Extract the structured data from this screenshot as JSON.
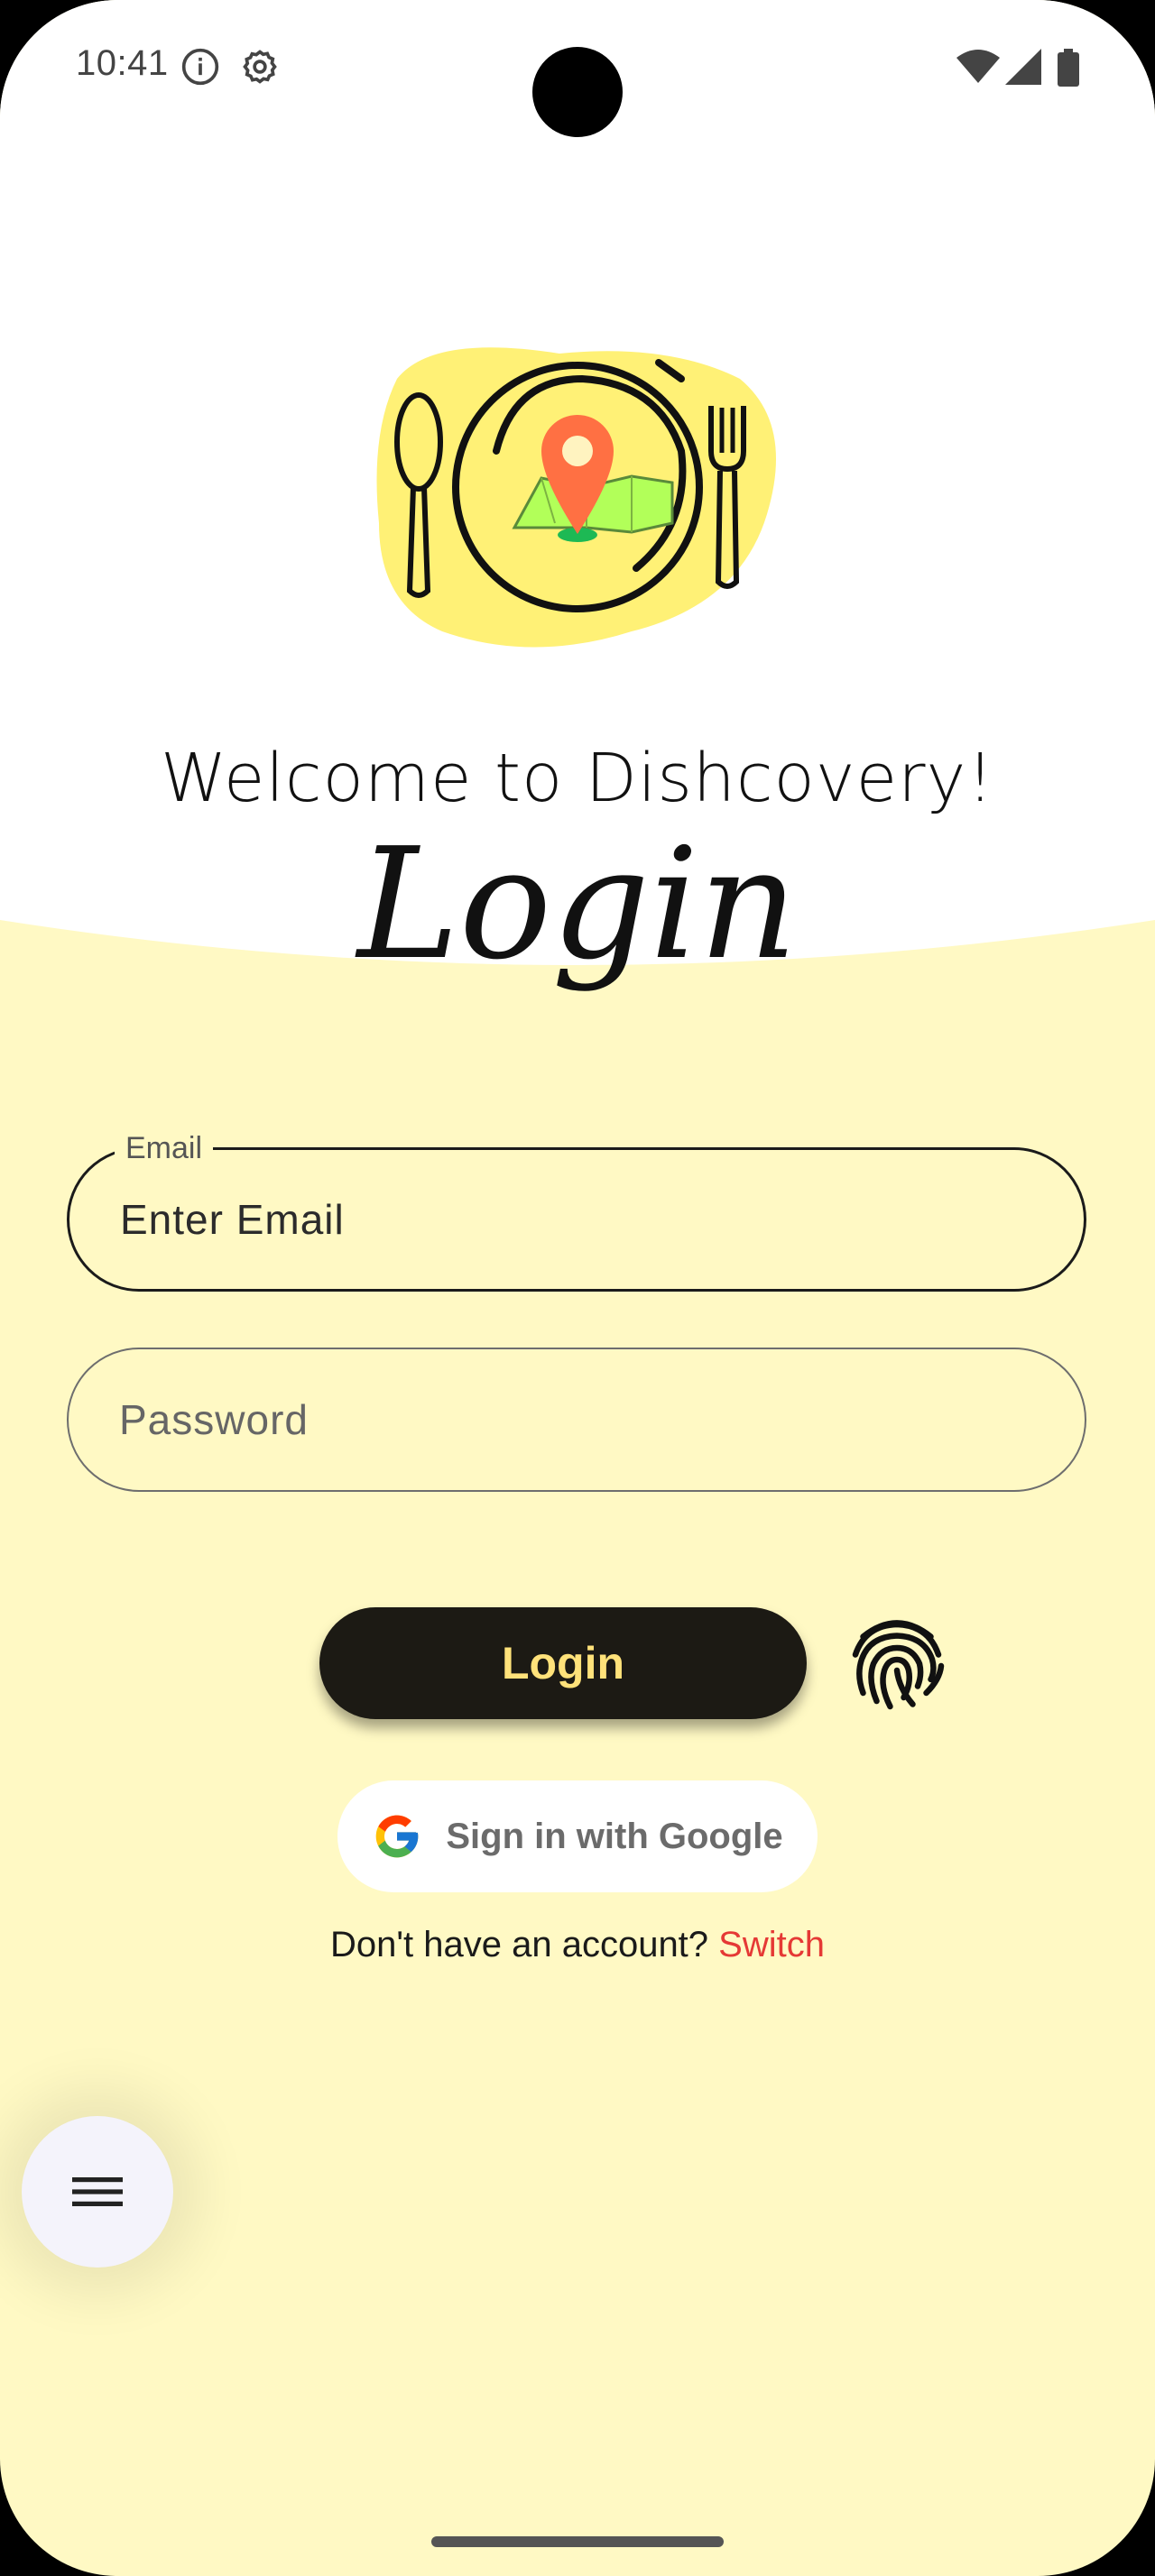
{
  "status_bar": {
    "time": "10:41",
    "icons": [
      "info-icon",
      "settings-icon",
      "wifi-icon",
      "signal-icon",
      "battery-icon"
    ]
  },
  "header": {
    "welcome": "Welcome to Dishcovery!",
    "title": "Login"
  },
  "form": {
    "email": {
      "label": "Email",
      "placeholder": "Enter Email"
    },
    "password": {
      "placeholder": "Password"
    },
    "login_label": "Login",
    "google_label": "Sign in with Google",
    "signup_prompt": "Don't have an account?",
    "switch_label": "Switch"
  },
  "colors": {
    "background": "#FFF9C4",
    "button": "#1C1A14",
    "button_text": "#FFE27A",
    "link": "#E53935"
  }
}
